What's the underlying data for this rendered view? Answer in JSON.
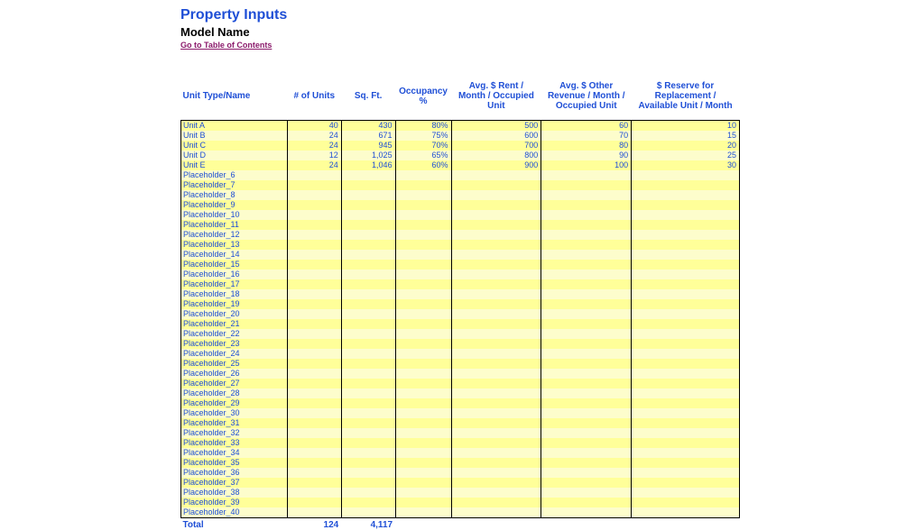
{
  "header": {
    "title": "Property Inputs",
    "subtitle": "Model Name",
    "toc_link": "Go to Table of Contents"
  },
  "columns": {
    "name": "Unit Type/Name",
    "units": "# of Units",
    "sqft": "Sq. Ft.",
    "occupancy": "Occupancy %",
    "rent": "Avg. $ Rent / Month / Occupied Unit",
    "other": "Avg. $ Other Revenue / Month / Occupied Unit",
    "reserve": "$ Reserve for Replacement / Available Unit / Month"
  },
  "rows": [
    {
      "name": "Unit A",
      "units": "40",
      "sqft": "430",
      "occ": "80%",
      "rent": "500",
      "other": "60",
      "reserve": "10"
    },
    {
      "name": "Unit B",
      "units": "24",
      "sqft": "671",
      "occ": "75%",
      "rent": "600",
      "other": "70",
      "reserve": "15"
    },
    {
      "name": "Unit C",
      "units": "24",
      "sqft": "945",
      "occ": "70%",
      "rent": "700",
      "other": "80",
      "reserve": "20"
    },
    {
      "name": "Unit D",
      "units": "12",
      "sqft": "1,025",
      "occ": "65%",
      "rent": "800",
      "other": "90",
      "reserve": "25"
    },
    {
      "name": "Unit E",
      "units": "24",
      "sqft": "1,046",
      "occ": "60%",
      "rent": "900",
      "other": "100",
      "reserve": "30"
    },
    {
      "name": "Placeholder_6"
    },
    {
      "name": "Placeholder_7"
    },
    {
      "name": "Placeholder_8"
    },
    {
      "name": "Placeholder_9"
    },
    {
      "name": "Placeholder_10"
    },
    {
      "name": "Placeholder_11"
    },
    {
      "name": "Placeholder_12"
    },
    {
      "name": "Placeholder_13"
    },
    {
      "name": "Placeholder_14"
    },
    {
      "name": "Placeholder_15"
    },
    {
      "name": "Placeholder_16"
    },
    {
      "name": "Placeholder_17"
    },
    {
      "name": "Placeholder_18"
    },
    {
      "name": "Placeholder_19"
    },
    {
      "name": "Placeholder_20"
    },
    {
      "name": "Placeholder_21"
    },
    {
      "name": "Placeholder_22"
    },
    {
      "name": "Placeholder_23"
    },
    {
      "name": "Placeholder_24"
    },
    {
      "name": "Placeholder_25"
    },
    {
      "name": "Placeholder_26"
    },
    {
      "name": "Placeholder_27"
    },
    {
      "name": "Placeholder_28"
    },
    {
      "name": "Placeholder_29"
    },
    {
      "name": "Placeholder_30"
    },
    {
      "name": "Placeholder_31"
    },
    {
      "name": "Placeholder_32"
    },
    {
      "name": "Placeholder_33"
    },
    {
      "name": "Placeholder_34"
    },
    {
      "name": "Placeholder_35"
    },
    {
      "name": "Placeholder_36"
    },
    {
      "name": "Placeholder_37"
    },
    {
      "name": "Placeholder_38"
    },
    {
      "name": "Placeholder_39"
    },
    {
      "name": "Placeholder_40"
    }
  ],
  "total": {
    "label": "Total",
    "units": "124",
    "sqft": "4,117"
  },
  "chart_data": {
    "type": "table",
    "title": "Property Inputs",
    "columns": [
      "Unit Type/Name",
      "# of Units",
      "Sq. Ft.",
      "Occupancy %",
      "Avg. $ Rent / Month / Occupied Unit",
      "Avg. $ Other Revenue / Month / Occupied Unit",
      "$ Reserve for Replacement / Available Unit / Month"
    ],
    "data": [
      [
        "Unit A",
        40,
        430,
        80,
        500,
        60,
        10
      ],
      [
        "Unit B",
        24,
        671,
        75,
        600,
        70,
        15
      ],
      [
        "Unit C",
        24,
        945,
        70,
        700,
        80,
        20
      ],
      [
        "Unit D",
        12,
        1025,
        65,
        800,
        90,
        25
      ],
      [
        "Unit E",
        24,
        1046,
        60,
        900,
        100,
        30
      ]
    ],
    "totals": {
      "units": 124,
      "sqft": 4117
    }
  }
}
